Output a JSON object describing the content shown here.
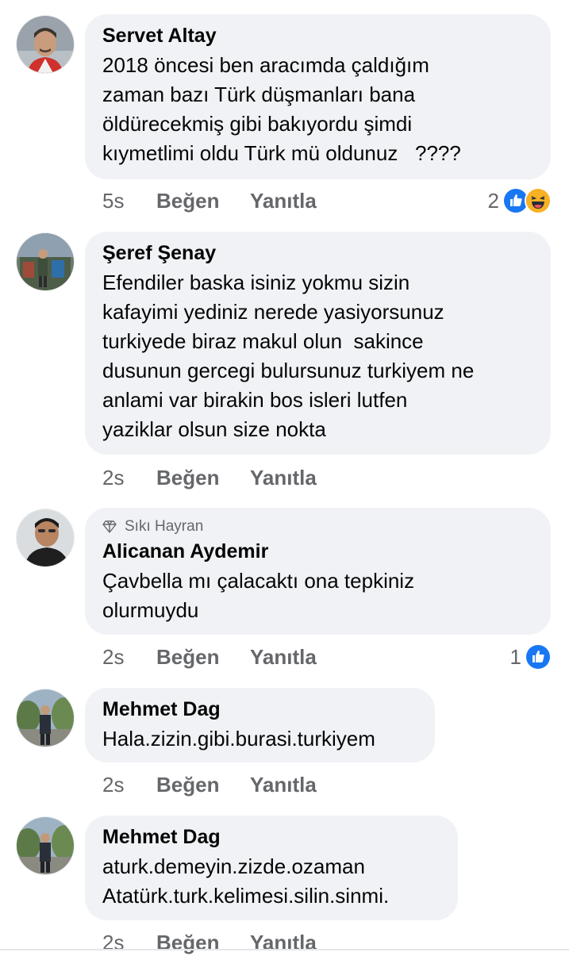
{
  "comments": [
    {
      "author": "Servet Altay",
      "lines": [
        "2018 öncesi ben aracımda çaldığım",
        "zaman bazı Türk düşmanları bana",
        "öldürecekmiş gibi bakıyordu şimdi",
        "kıymetlimi oldu Türk mü oldunuz   ????"
      ],
      "time": "5s",
      "like_label": "Beğen",
      "reply_label": "Yanıtla",
      "reaction_count": "2",
      "reactions": [
        "like-icon",
        "haha-icon"
      ]
    },
    {
      "author": "Şeref Şenay",
      "lines": [
        "Efendiler baska isiniz yokmu sizin",
        "kafayimi yediniz nerede yasiyorsunuz",
        "turkiyede biraz makul olun  sakince",
        "dusunun gercegi bulursunuz turkiyem ne",
        "anlami var birakin bos isleri lutfen",
        "yaziklar olsun size nokta"
      ],
      "time": "2s",
      "like_label": "Beğen",
      "reply_label": "Yanıtla"
    },
    {
      "badge": "Sıkı Hayran",
      "badge_icon": "diamond-icon",
      "author": "Alicanan Aydemir",
      "lines": [
        "Çavbella mı çalacaktı ona tepkiniz",
        "olurmuydu"
      ],
      "time": "2s",
      "like_label": "Beğen",
      "reply_label": "Yanıtla",
      "reaction_count": "1",
      "reactions": [
        "like-icon"
      ]
    },
    {
      "author": "Mehmet Dag",
      "lines": [
        "Hala.zizin.gibi.burasi.turkiyem"
      ],
      "time": "2s",
      "like_label": "Beğen",
      "reply_label": "Yanıtla"
    },
    {
      "author": "Mehmet Dag",
      "lines": [
        "aturk.demeyin.zizde.ozaman",
        "Atatürk.turk.kelimesi.silin.sinmi."
      ],
      "time": "2s",
      "like_label": "Beğen",
      "reply_label": "Yanıtla"
    }
  ],
  "colors": {
    "bubble": "#f0f2f5",
    "secondary_text": "#65676b",
    "like_blue": "#1877f2",
    "haha_yellow": "#f7b125"
  }
}
